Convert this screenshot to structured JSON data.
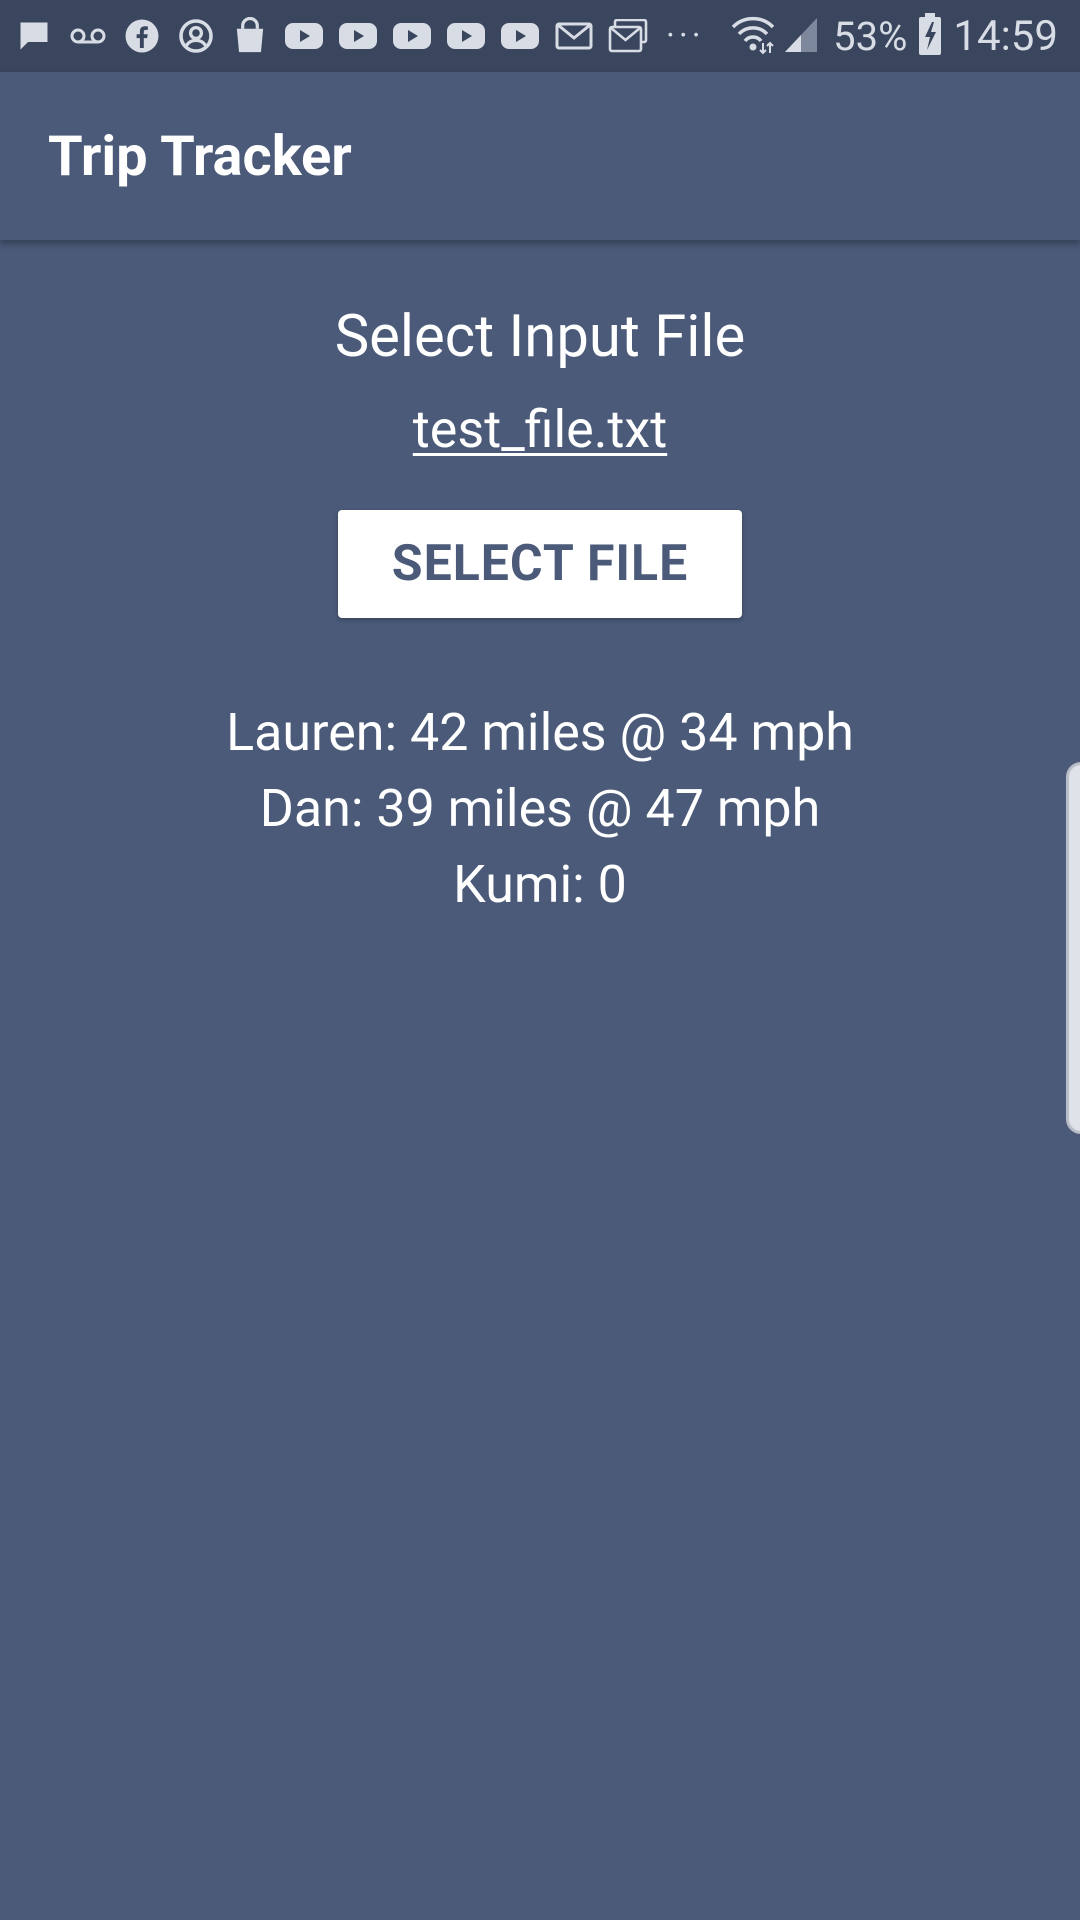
{
  "status_bar": {
    "notification_icons": [
      "message-icon",
      "voicemail-icon",
      "facebook-icon",
      "account-icon",
      "shopping-bag-icon",
      "youtube-icon",
      "youtube-icon",
      "youtube-icon",
      "youtube-icon",
      "youtube-icon",
      "gmail-icon",
      "mail-stack-icon"
    ],
    "more_indicator": "···",
    "battery_percent": "53%",
    "time": "14:59"
  },
  "app_bar": {
    "title": "Trip Tracker"
  },
  "main": {
    "section_title": "Select Input File",
    "file_name": "test_file.txt",
    "select_button_label": "SELECT FILE",
    "results": [
      "Lauren: 42 miles @ 34 mph",
      "Dan: 39 miles @ 47 mph",
      "Kumi: 0"
    ]
  },
  "colors": {
    "background": "#4a5a78",
    "status_bar": "#3a465e",
    "button_background": "#ffffff",
    "button_text": "#4a5a78",
    "text": "#ffffff"
  }
}
